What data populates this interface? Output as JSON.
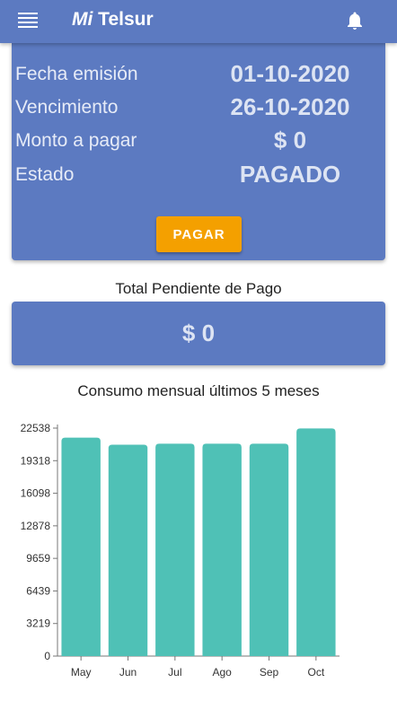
{
  "appbar": {
    "title_prefix": "Mi",
    "title_main": "Telsur",
    "menu_icon": "menu-icon",
    "bell_icon": "bell-icon"
  },
  "bill": {
    "rows": [
      {
        "label": "Fecha emisión",
        "value": "01-10-2020"
      },
      {
        "label": "Vencimiento",
        "value": "26-10-2020"
      },
      {
        "label": "Monto a pagar",
        "value": "$ 0"
      },
      {
        "label": "Estado",
        "value": "PAGADO"
      }
    ],
    "pay_label": "PAGAR"
  },
  "pending": {
    "title": "Total Pendiente de Pago",
    "value": "$ 0"
  },
  "chart_data": {
    "type": "bar",
    "title": "Consumo mensual últimos 5 meses",
    "categories": [
      "May",
      "Jun",
      "Jul",
      "Ago",
      "Sep",
      "Oct"
    ],
    "values": [
      21600,
      20900,
      21000,
      21000,
      21000,
      22500
    ],
    "yticks": [
      0,
      3219,
      6439,
      9659,
      12878,
      16098,
      19318,
      22538
    ],
    "ylim": [
      0,
      22538
    ],
    "xlabel": "",
    "ylabel": "",
    "grid": false,
    "bar_color": "#4fc1b6"
  },
  "colors": {
    "primary": "#5c7ac1",
    "accent": "#f4a000",
    "bar": "#4fc1b6"
  }
}
